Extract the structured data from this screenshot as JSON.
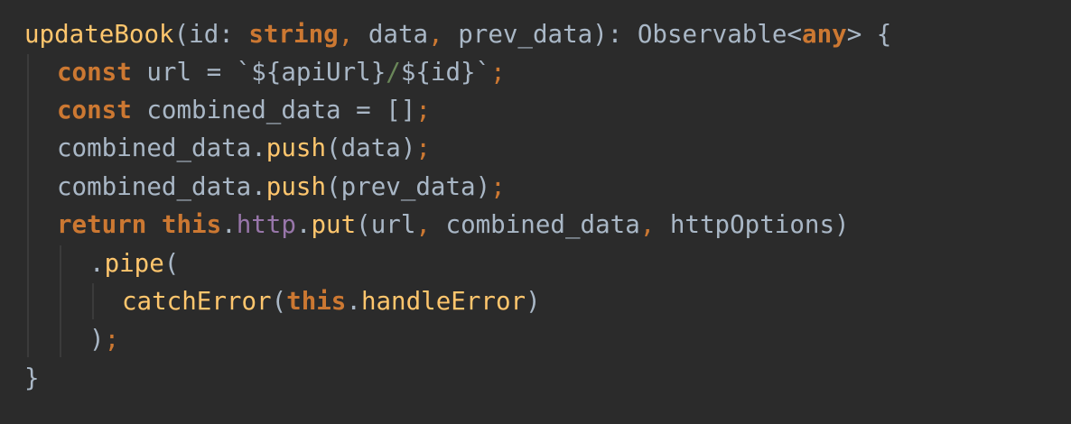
{
  "code": {
    "lines": [
      [
        {
          "t": "updateBook",
          "c": "fn"
        },
        {
          "t": "(id: ",
          "c": "def"
        },
        {
          "t": "string",
          "c": "kw"
        },
        {
          "t": ", ",
          "c": "pun"
        },
        {
          "t": "data",
          "c": "def"
        },
        {
          "t": ", ",
          "c": "pun"
        },
        {
          "t": "prev_data): Observable<",
          "c": "def"
        },
        {
          "t": "any",
          "c": "kw"
        },
        {
          "t": "> {",
          "c": "def"
        }
      ],
      [
        {
          "t": "const ",
          "c": "kw"
        },
        {
          "t": "url = `${apiUrl}",
          "c": "def"
        },
        {
          "t": "/",
          "c": "str"
        },
        {
          "t": "${id}`",
          "c": "def"
        },
        {
          "t": ";",
          "c": "pun"
        }
      ],
      [
        {
          "t": "const ",
          "c": "kw"
        },
        {
          "t": "combined_data = []",
          "c": "def"
        },
        {
          "t": ";",
          "c": "pun"
        }
      ],
      [
        {
          "t": "combined_data.",
          "c": "def"
        },
        {
          "t": "push",
          "c": "fn"
        },
        {
          "t": "(data)",
          "c": "def"
        },
        {
          "t": ";",
          "c": "pun"
        }
      ],
      [
        {
          "t": "combined_data.",
          "c": "def"
        },
        {
          "t": "push",
          "c": "fn"
        },
        {
          "t": "(prev_data)",
          "c": "def"
        },
        {
          "t": ";",
          "c": "pun"
        }
      ],
      [
        {
          "t": "return this",
          "c": "kw"
        },
        {
          "t": ".",
          "c": "def"
        },
        {
          "t": "http",
          "c": "fld"
        },
        {
          "t": ".",
          "c": "def"
        },
        {
          "t": "put",
          "c": "fn"
        },
        {
          "t": "(url",
          "c": "def"
        },
        {
          "t": ", ",
          "c": "pun"
        },
        {
          "t": "combined_data",
          "c": "def"
        },
        {
          "t": ", ",
          "c": "pun"
        },
        {
          "t": "httpOptions)",
          "c": "def"
        }
      ],
      [
        {
          "t": ".",
          "c": "def"
        },
        {
          "t": "pipe",
          "c": "fn"
        },
        {
          "t": "(",
          "c": "def"
        }
      ],
      [
        {
          "t": "catchError",
          "c": "fn"
        },
        {
          "t": "(",
          "c": "def"
        },
        {
          "t": "this",
          "c": "kw"
        },
        {
          "t": ".",
          "c": "def"
        },
        {
          "t": "handleError",
          "c": "fn"
        },
        {
          "t": ")",
          "c": "def"
        }
      ],
      [
        {
          "t": ")",
          "c": "def"
        },
        {
          "t": ";",
          "c": "pun"
        }
      ],
      [
        {
          "t": "}",
          "c": "def"
        }
      ]
    ]
  },
  "colors": {
    "background": "#2b2b2b",
    "default_text": "#a9b7c6",
    "keyword": "#cc7832",
    "function_name": "#ffc66d",
    "string": "#6a8759",
    "field": "#9876aa",
    "indent_guide": "#3b3b3b"
  }
}
